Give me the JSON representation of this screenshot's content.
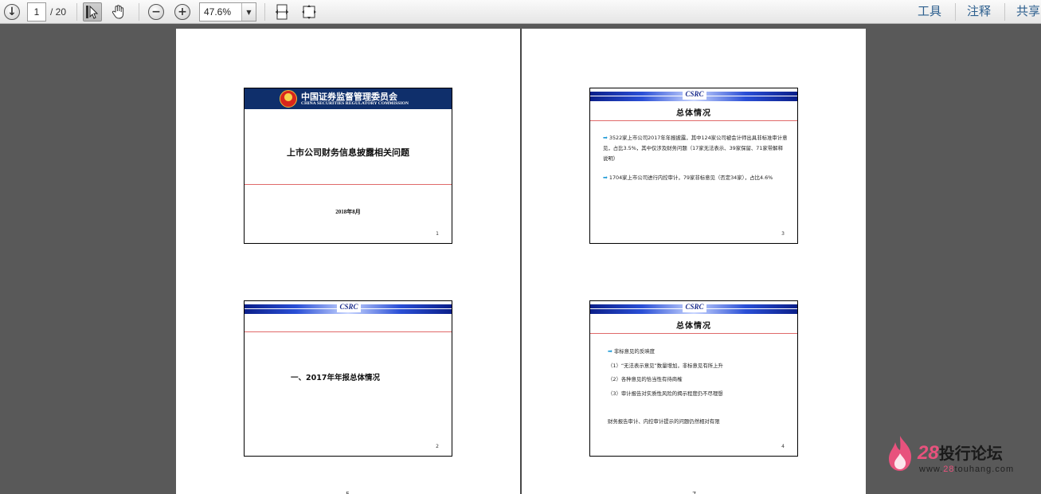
{
  "toolbar": {
    "current_page": "1",
    "total_pages": "/ 20",
    "zoom": "47.6%",
    "right_links": [
      "工具",
      "注释",
      "共享"
    ]
  },
  "slides": {
    "s1": {
      "org_cn": "中国证券监督管理委员会",
      "org_en": "CHINA SECURITIES REGULATORY COMMISSION",
      "title": "上市公司财务信息披露相关问题",
      "date": "2018年8月",
      "num": "1"
    },
    "s2": {
      "logo": "CSRC",
      "title": "一、2017年年报总体情况",
      "num": "2"
    },
    "s3": {
      "logo": "CSRC",
      "title": "总体情况",
      "bullet1": "3522家上市公司2017年年报披露，其中124家公司被会计师出具非标准审计意见，占比3.5%，其中仅涉及财务问题（17家无法表示、39家保留、71家带解释说明）",
      "bullet2": "1704家上市公司进行内控审计，79家非标意见（否定34家），占比4.6%",
      "num": "3"
    },
    "s4": {
      "logo": "CSRC",
      "title": "总体情况",
      "heading": "非标意见的反映度",
      "line1": "（1）“无法表示意见”数量增加，非标意见有所上升",
      "line2": "（2）各种意见的恰当性有待商榷",
      "line3": "（3）审计报告对实质性风险的揭示程度仍不尽理想",
      "line4": "财务报告审计、内控审计提示的问题仍然相对有限",
      "num": "4"
    }
  },
  "watermark": {
    "num": "28",
    "name": "投行论坛",
    "url_prefix": "www.",
    "url_mid": "28",
    "url_suffix": "touhang.com"
  },
  "bottom_marks": [
    "5",
    "7"
  ]
}
